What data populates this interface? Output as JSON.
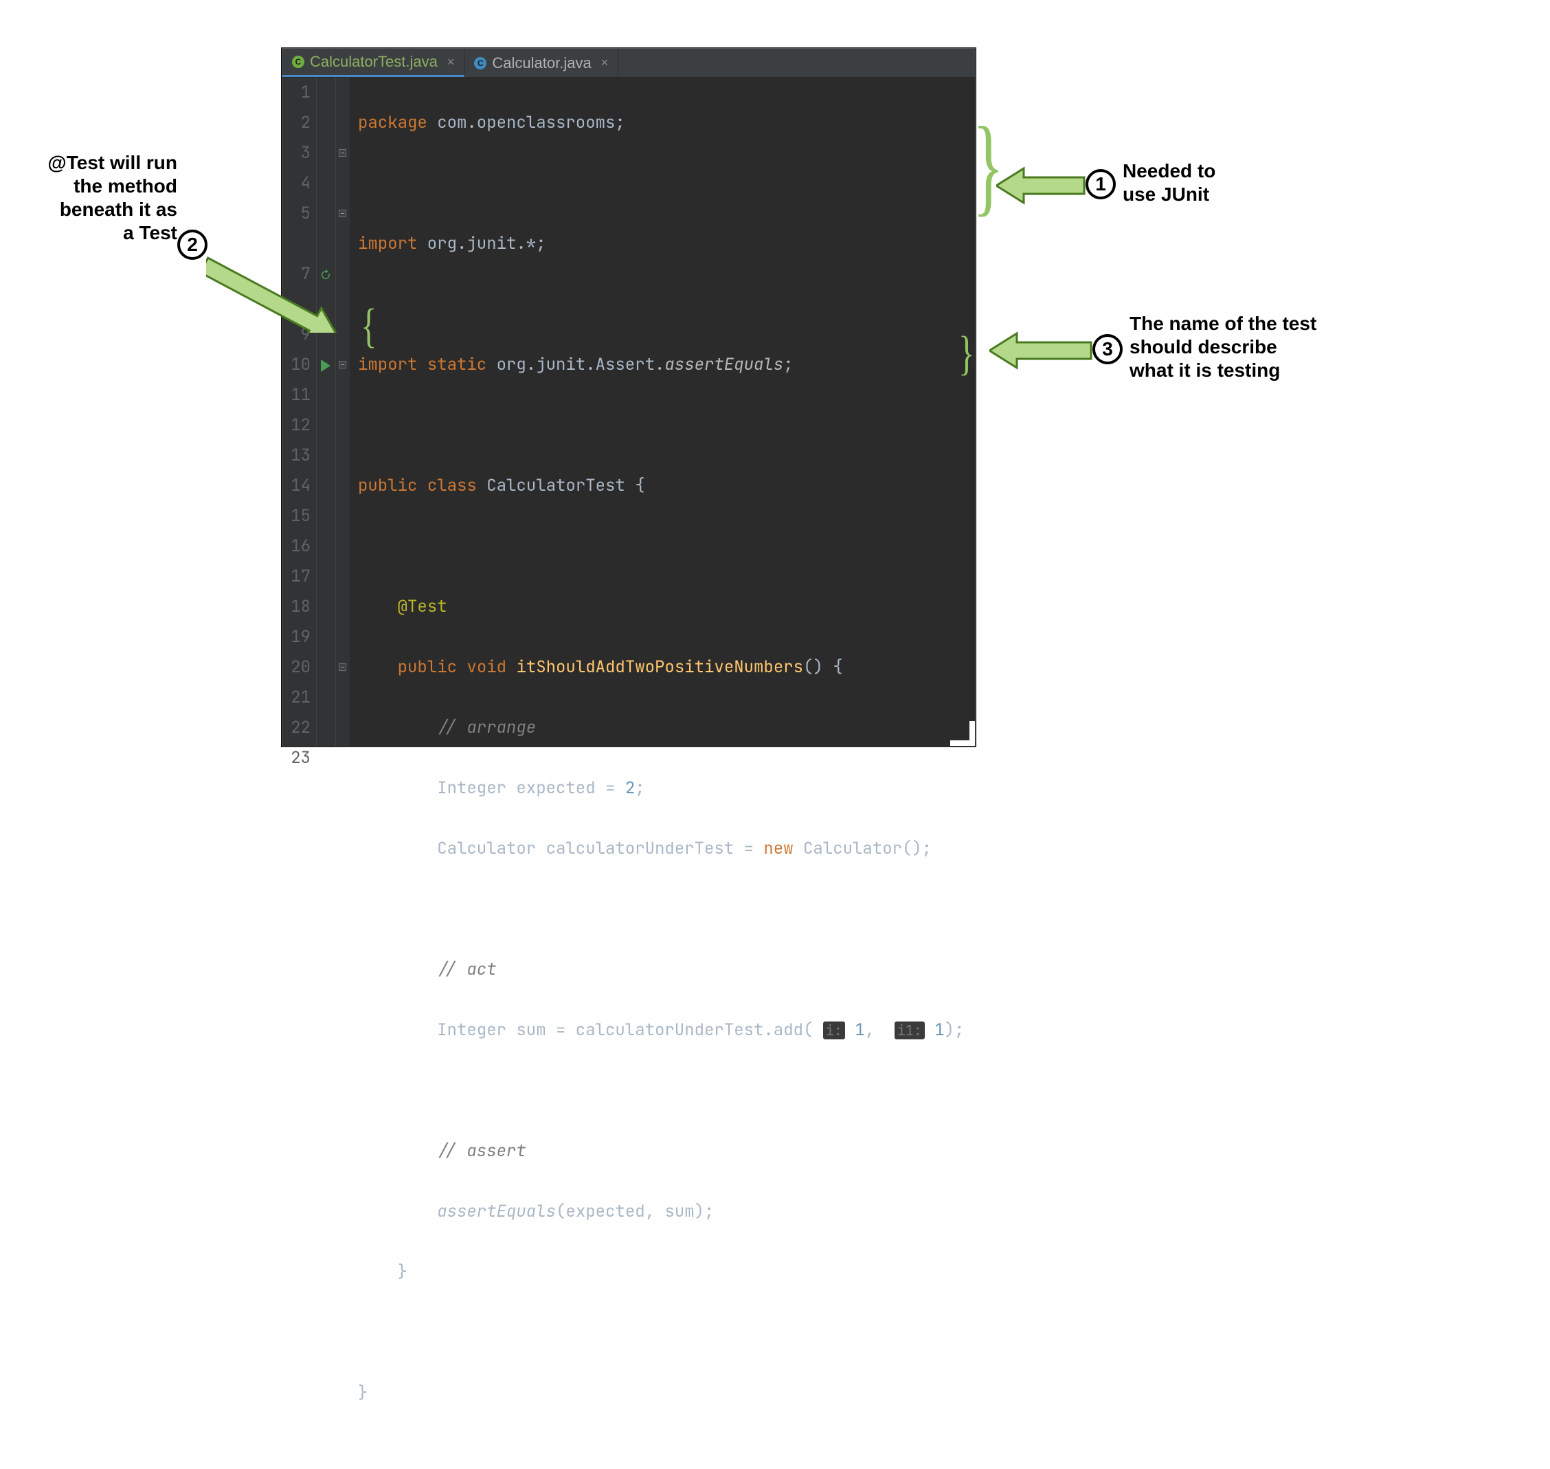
{
  "tabs": {
    "active": {
      "label": "CalculatorTest.java"
    },
    "inactive": {
      "label": "Calculator.java"
    }
  },
  "gutter": [
    "1",
    "2",
    "3",
    "4",
    "5",
    "",
    "7",
    "",
    "9",
    "10",
    "11",
    "12",
    "13",
    "14",
    "15",
    "16",
    "17",
    "18",
    "19",
    "20",
    "21",
    "22",
    "23"
  ],
  "code": {
    "l1": {
      "kw": "package",
      "rest": " com.openclassrooms;"
    },
    "l3": {
      "kw": "import",
      "rest": " org.junit.*;"
    },
    "l5a": "import static",
    "l5b": " org.junit.Assert.",
    "l5c": "assertEquals",
    "l5d": ";",
    "l7": {
      "kw1": "public",
      "kw2": "class",
      "cls": "CalculatorTest",
      "br": " {"
    },
    "l9": "@Test",
    "l10": {
      "kw1": "public",
      "kw2": "void",
      "fn": "itShouldAddTwoPositiveNumbers",
      "rest": "() {"
    },
    "l11": "// arrange",
    "l12": {
      "a": "Integer expected = ",
      "n": "2",
      "b": ";"
    },
    "l13": {
      "a": "Calculator calculatorUnderTest = ",
      "kw": "new",
      "b": " Calculator();"
    },
    "l15": "// act",
    "l16": {
      "a": "Integer sum = calculatorUnderTest.add( ",
      "h1": "i:",
      "n1": " 1",
      "c": ",  ",
      "h2": "i1:",
      "n2": " 1",
      "b": ");"
    },
    "l18": "// assert",
    "l19": {
      "fn": "assertEquals",
      "rest": "(expected, sum);"
    },
    "l20": "}",
    "l22": "}"
  },
  "annotations": {
    "a1": {
      "num": "1",
      "text": "Needed to\nuse JUnit"
    },
    "a2": {
      "num": "2",
      "text": "@Test will run\nthe method\nbeneath it as\na Test"
    },
    "a3": {
      "num": "3",
      "text": "The name of the test\nshould describe\nwhat it is testing"
    }
  }
}
